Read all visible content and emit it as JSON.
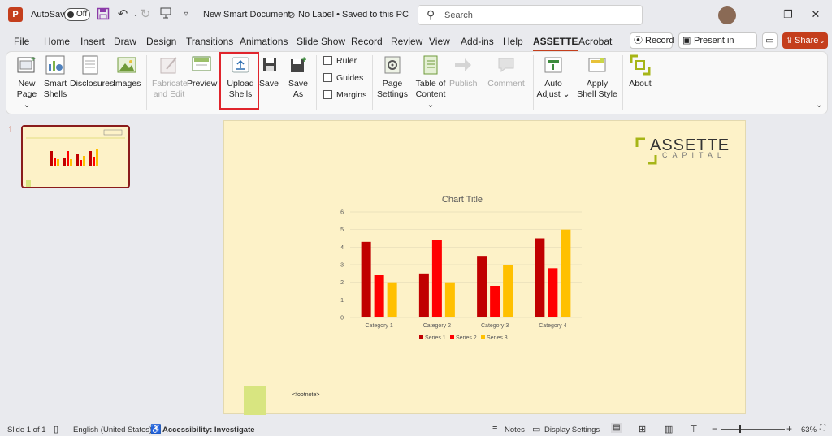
{
  "titlebar": {
    "app_badge": "P",
    "autosave_label": "AutoSave",
    "autosave_state": "Off",
    "doc_title": "New Smart Document",
    "label_status": "No Label • Saved to this PC",
    "search_placeholder": "Search"
  },
  "tabs": [
    "File",
    "Home",
    "Insert",
    "Draw",
    "Design",
    "Transitions",
    "Animations",
    "Slide Show",
    "Record",
    "Review",
    "View",
    "Add-ins",
    "Help",
    "ASSETTE",
    "Acrobat"
  ],
  "tab_actions": {
    "record": "Record",
    "present_teams": "Present in Teams",
    "share": "Share"
  },
  "ribbon": {
    "new_page": [
      "New",
      "Page ⌄"
    ],
    "smart_shells": [
      "Smart",
      "Shells"
    ],
    "disclosures": "Disclosures",
    "images": "Images",
    "fabricate": [
      "Fabricate",
      "and Edit"
    ],
    "preview": "Preview",
    "upload_shells": [
      "Upload",
      "Shells"
    ],
    "save": "Save",
    "save_as": [
      "Save",
      "As"
    ],
    "ruler": "Ruler",
    "guides": "Guides",
    "margins": "Margins",
    "page_settings": [
      "Page",
      "Settings"
    ],
    "table_of_content": [
      "Table of",
      "Content ⌄"
    ],
    "publish": "Publish",
    "comment": "Comment",
    "auto_adjust": [
      "Auto",
      "Adjust ⌄"
    ],
    "apply_shell_style": [
      "Apply",
      "Shell Style"
    ],
    "about": "About"
  },
  "thumbnails": {
    "slide_number": "1"
  },
  "slide": {
    "logo_top": "ASSETTE",
    "logo_bottom": "CAPITAL",
    "footnote": "<footnote>"
  },
  "colors": {
    "accent": "#c43e1c",
    "series1": "#c00000",
    "series2": "#ff0000",
    "series3": "#ffc000",
    "slide_bg": "#fdf2c8",
    "logo_green": "#a6b517"
  },
  "chart_data": {
    "type": "bar",
    "title": "Chart Title",
    "categories": [
      "Category 1",
      "Category 2",
      "Category 3",
      "Category 4"
    ],
    "series": [
      {
        "name": "Series 1",
        "values": [
          4.3,
          2.5,
          3.5,
          4.5
        ]
      },
      {
        "name": "Series 2",
        "values": [
          2.4,
          4.4,
          1.8,
          2.8
        ]
      },
      {
        "name": "Series 3",
        "values": [
          2,
          2,
          3,
          5
        ]
      }
    ],
    "ylim": [
      0,
      6
    ],
    "yticks": [
      "0",
      "1",
      "2",
      "3",
      "4",
      "5",
      "6"
    ],
    "grid": true,
    "legend": "bottom"
  },
  "status": {
    "slide_info": "Slide 1 of 1",
    "language": "English (United States)",
    "accessibility": "Accessibility: Investigate",
    "notes": "Notes",
    "display_settings": "Display Settings",
    "zoom": "63%"
  }
}
